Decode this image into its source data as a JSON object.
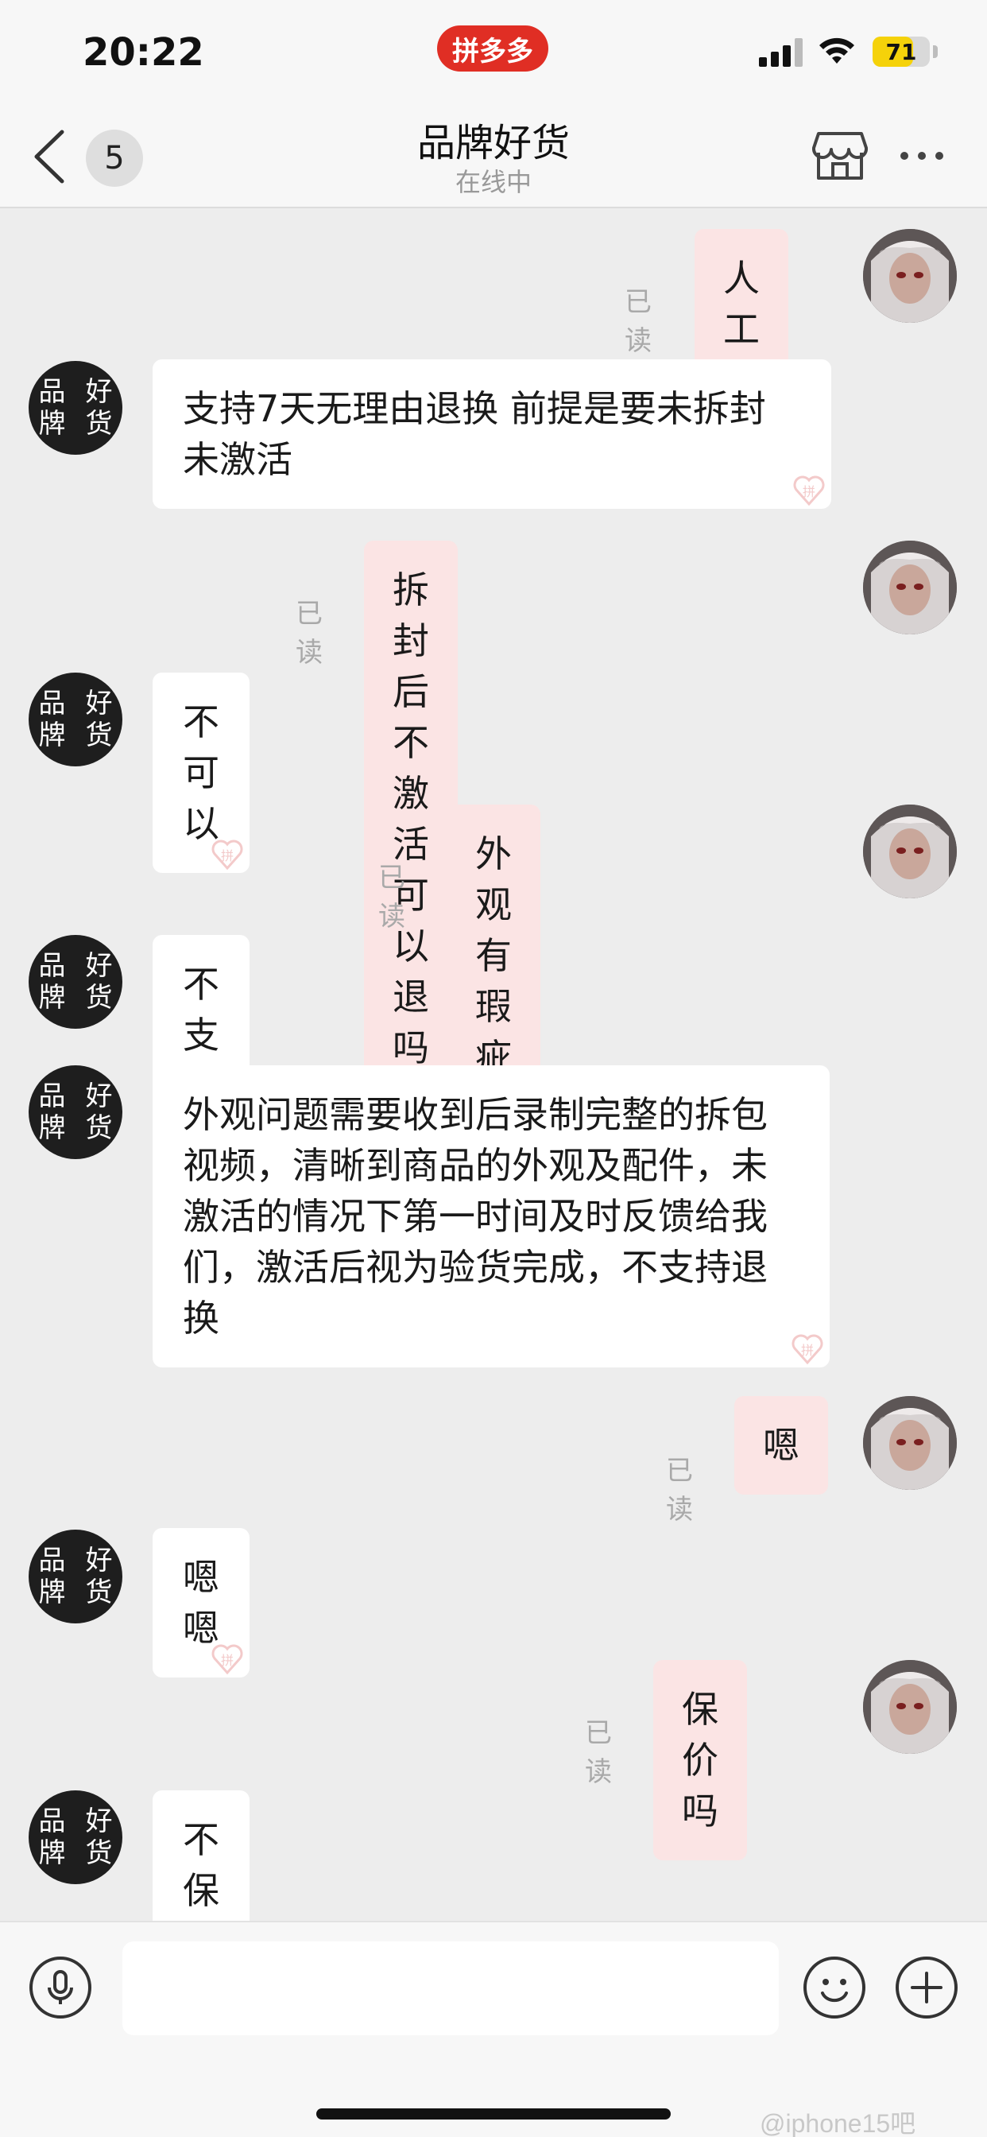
{
  "status_bar": {
    "time": "20:22",
    "app_badge": "拼多多",
    "battery_level": "71",
    "battery_fraction": 0.71
  },
  "header": {
    "back_label": "<",
    "unread_count": "5",
    "title": "品牌好货",
    "subtitle": "在线中"
  },
  "shop_avatar_text": "品牌好货",
  "read_receipt": "已读",
  "messages": [
    {
      "from": "user",
      "text": "人工",
      "read": "已读"
    },
    {
      "from": "shop",
      "text": "支持7天无理由退换 前提是要未拆封未激活"
    },
    {
      "from": "user",
      "text": "拆封后不激活可以退吗",
      "read": "已读"
    },
    {
      "from": "shop",
      "text": "不可以"
    },
    {
      "from": "user",
      "text": "外观有瑕疵的话呢",
      "read": "已读"
    },
    {
      "from": "shop",
      "text": "不支持试用"
    },
    {
      "from": "shop",
      "text": "外观问题需要收到后录制完整的拆包视频，清晰到商品的外观及配件，未激活的情况下第一时间及时反馈给我们，激活后视为验货完成，不支持退换"
    },
    {
      "from": "user",
      "text": "嗯",
      "read": "已读"
    },
    {
      "from": "shop",
      "text": "嗯嗯"
    },
    {
      "from": "user",
      "text": "保价吗",
      "read": "已读"
    },
    {
      "from": "shop",
      "text": "不保价"
    }
  ],
  "input": {
    "placeholder": ""
  },
  "watermark": "@iphone15吧",
  "colors": {
    "accent": "#e02e24",
    "user_bubble": "#fbe4e4",
    "shop_bubble": "#ffffff",
    "background": "#ededed"
  },
  "icons": [
    "back-icon",
    "store-icon",
    "more-icon",
    "microphone-icon",
    "emoji-icon",
    "plus-icon",
    "signal-icon",
    "wifi-icon",
    "battery-icon"
  ]
}
